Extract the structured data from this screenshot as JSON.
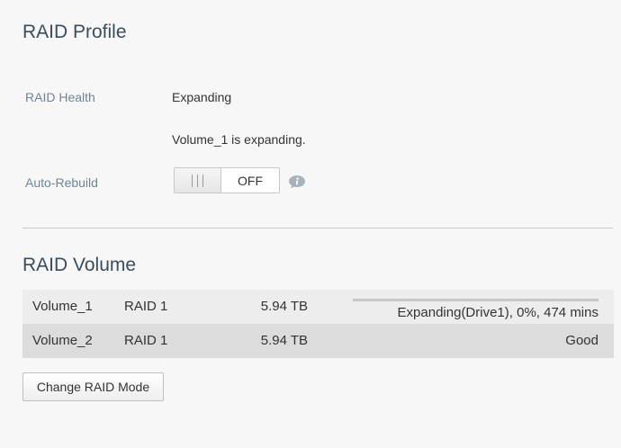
{
  "raid_profile": {
    "title": "RAID Profile",
    "health_label": "RAID Health",
    "health_value": "Expanding",
    "health_message": "Volume_1 is expanding.",
    "auto_rebuild_label": "Auto-Rebuild",
    "auto_rebuild_state": "OFF",
    "info_icon": "info-icon"
  },
  "raid_volume": {
    "title": "RAID Volume",
    "rows": [
      {
        "name": "Volume_1",
        "raid": "RAID 1",
        "size": "5.94 TB",
        "status": "Expanding(Drive1), 0%, 474 mins",
        "progress": 0
      },
      {
        "name": "Volume_2",
        "raid": "RAID 1",
        "size": "5.94 TB",
        "status": "Good"
      }
    ],
    "change_mode_button": "Change RAID Mode"
  },
  "colors": {
    "label": "#6f8596",
    "heading": "#3a4d5c",
    "row_odd": "#ededed",
    "row_even": "#dcdcdc",
    "progress_track": "#c8c8c8",
    "info_icon": "#a9b3bb"
  }
}
